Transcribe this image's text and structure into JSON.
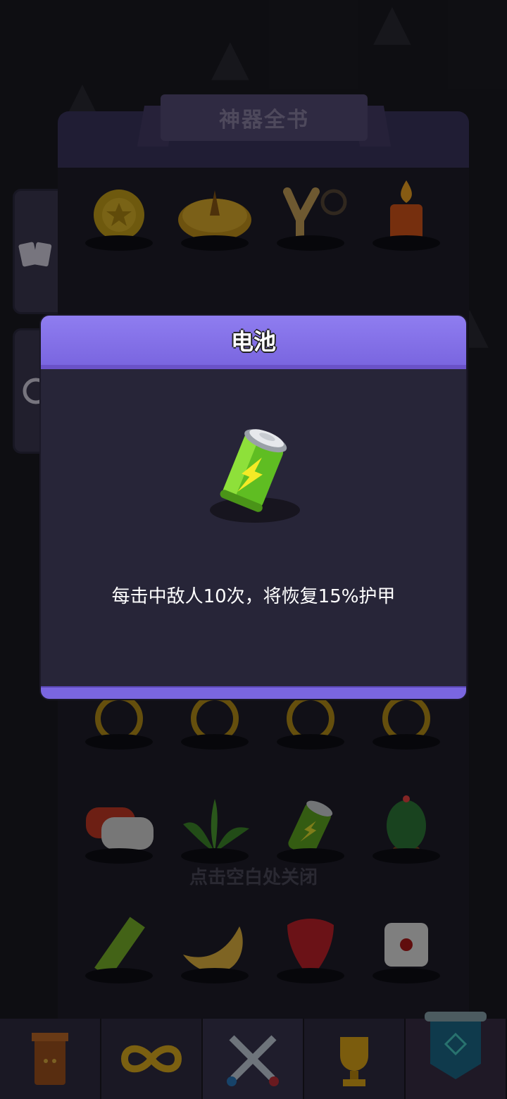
{
  "book": {
    "title": "神器全书",
    "close_hint": "点击空白处关闭",
    "grid_rows": [
      [
        "coin-item-icon",
        "sundial-item-icon",
        "slingshot-item-icon",
        "candle-item-icon"
      ],
      [
        "ring-item-icon",
        "ring-item-icon",
        "ring-item-icon",
        "ring-item-icon"
      ],
      [
        "earbuds-item-icon",
        "leaves-item-icon",
        "battery-item-icon",
        "cactus-item-icon"
      ],
      [
        "ruler-item-icon",
        "horn-item-icon",
        "guitar-pick-item-icon",
        "dice-item-icon"
      ]
    ]
  },
  "modal": {
    "title": "电池",
    "description": "每击中敌人10次，将恢复15%护甲",
    "icon": "battery-icon"
  },
  "nav": {
    "tabs": [
      {
        "icon": "cabinet-icon"
      },
      {
        "icon": "infinity-icon"
      },
      {
        "icon": "crossed-swords-icon"
      },
      {
        "icon": "trophy-icon"
      },
      {
        "icon": "shield-banner-icon"
      }
    ]
  },
  "colors": {
    "header_purple": "#8f7df0",
    "modal_body": "#272538",
    "battery_green": "#7ad12b"
  }
}
